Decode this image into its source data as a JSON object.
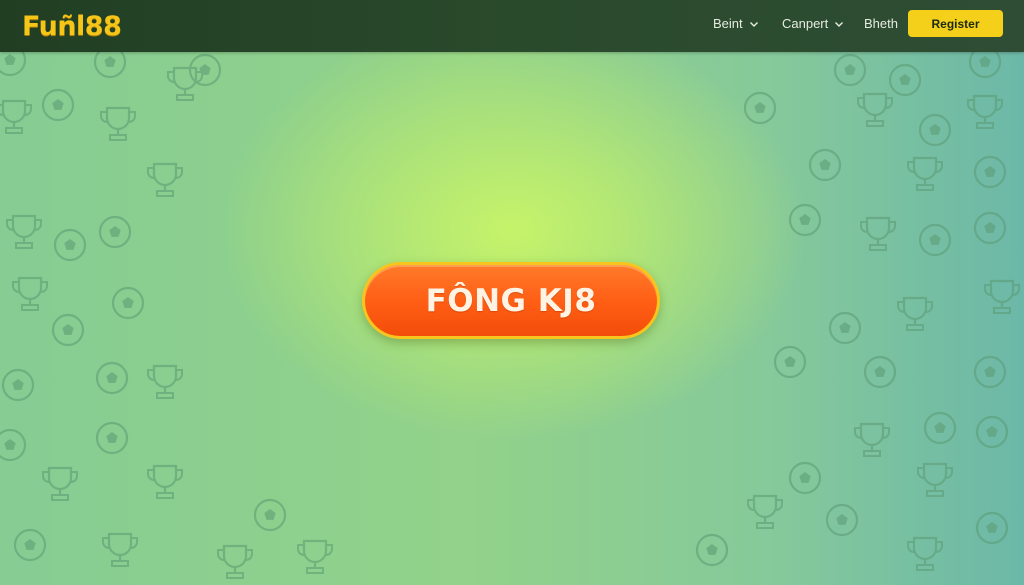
{
  "header": {
    "logo_text": "Fuñl88",
    "nav": [
      {
        "label": "Beint",
        "icon": "chevron-down-icon"
      },
      {
        "label": "Canpert",
        "icon": "chevron-down-icon"
      },
      {
        "label": "Bheth"
      }
    ],
    "register_label": "Register"
  },
  "main": {
    "cta_label": "FÔNG KJ8"
  },
  "colors": {
    "header_bg": "#263f28",
    "logo": "#f5c518",
    "register_bg": "#f4d01a",
    "cta_bg": "#ff5d14",
    "cta_border": "#f8c41e",
    "bg_center": "#c6f36a",
    "bg_edge": "#6cb8a8"
  },
  "background_pattern": [
    "trophy-icon",
    "soccer-ball-icon",
    "medal-icon"
  ]
}
